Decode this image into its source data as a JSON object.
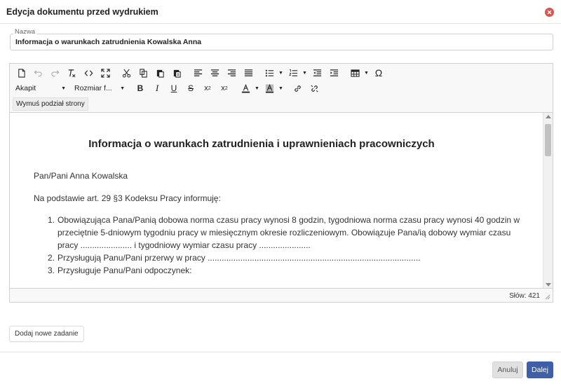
{
  "dialog": {
    "title": "Edycja dokumentu przed wydrukiem"
  },
  "name_field": {
    "label": "Nazwa",
    "value": "Informacja o warunkach zatrudnienia Kowalska Anna"
  },
  "toolbar": {
    "paragraph_format": "Akapit",
    "font_size": "Rozmiar f...",
    "page_break_label": "Wymuś podział strony",
    "icons": [
      "new-document-icon",
      "undo-icon",
      "redo-icon",
      "clear-format-icon",
      "source-code-icon",
      "fullscreen-icon",
      "cut-icon",
      "copy-icon",
      "paste-icon",
      "paste-text-icon",
      "align-left-icon",
      "align-center-icon",
      "align-right-icon",
      "justify-icon",
      "bullet-list-icon",
      "numbered-list-icon",
      "outdent-icon",
      "indent-icon",
      "table-icon",
      "special-char-icon",
      "bold-icon",
      "italic-icon",
      "underline-icon",
      "strikethrough-icon",
      "subscript-icon",
      "superscript-icon",
      "text-color-icon",
      "background-color-icon",
      "link-icon",
      "unlink-icon"
    ]
  },
  "document": {
    "title": "Informacja o warunkach zatrudnienia i uprawnieniach pracowniczych",
    "recipient": "Pan/Pani Anna Kowalska",
    "intro": "Na podstawie art. 29 §3 Kodeksu Pracy informuję:",
    "items": [
      {
        "num": "1.",
        "text": "Obowiązująca Pana/Panią dobowa norma czasu pracy wynosi 8 godzin, tygodniowa norma czasu pracy wynosi 40 godzin w przeciętnie 5-dniowym tygodniu pracy w miesięcznym okresie rozliczeniowym. Obowiązuje Pana/ią dobowy wymiar czasu pracy ...................... i tygodniowy wymiar czasu pracy ......................"
      },
      {
        "num": "2.",
        "text": "Przysługują Panu/Pani przerwy w pracy ..........................................................................................."
      },
      {
        "num": "3.",
        "text": "Przysługuje Panu/Pani odpoczynek:"
      }
    ]
  },
  "status": {
    "word_count": "Słów: 421"
  },
  "actions": {
    "add_task": "Dodaj nowe zadanie",
    "cancel": "Anuluj",
    "next": "Dalej"
  },
  "colors": {
    "primary": "#3f5fa8",
    "close": "#d9534f"
  }
}
